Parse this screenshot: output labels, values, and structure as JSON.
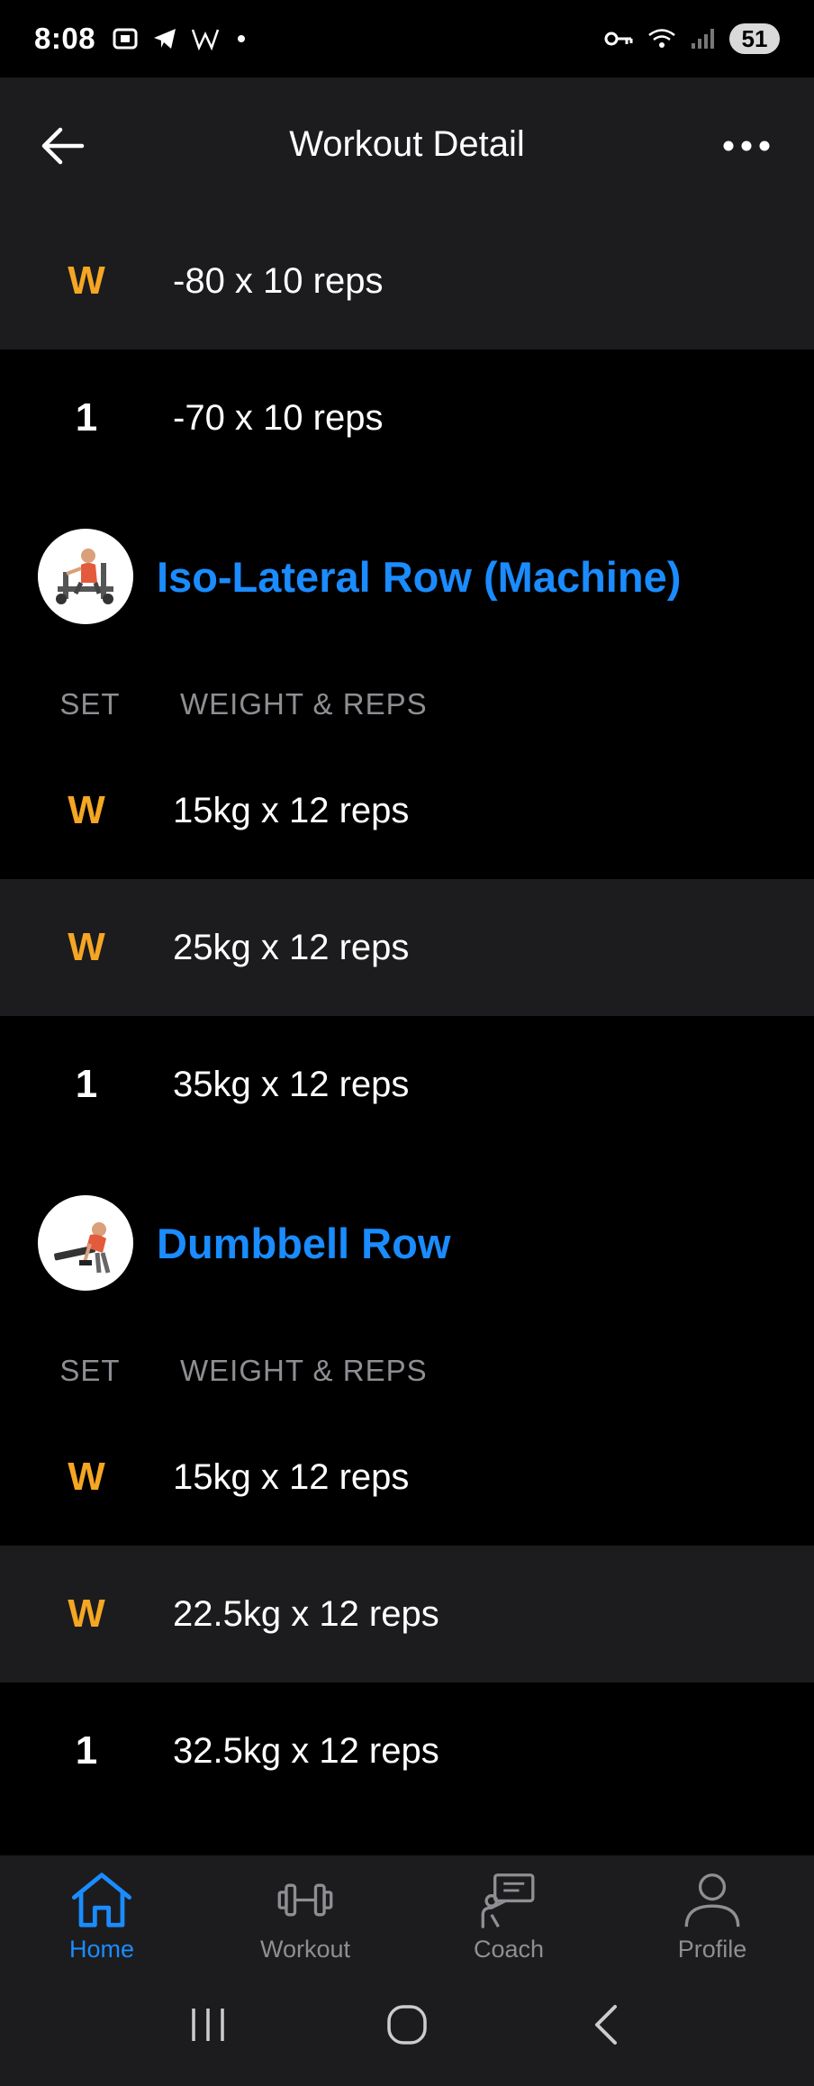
{
  "status_bar": {
    "time": "8:08",
    "left_icons": [
      "screenshot-icon",
      "telegram-icon",
      "w-icon",
      "dot-icon"
    ],
    "battery": "51"
  },
  "header": {
    "title": "Workout Detail"
  },
  "top_sets": [
    {
      "label": "W",
      "kind": "warmup",
      "value": "-80 x 10 reps"
    },
    {
      "label": "1",
      "kind": "normal",
      "value": "-70 x 10 reps"
    }
  ],
  "exercises": [
    {
      "name": "Iso-Lateral Row (Machine)",
      "col_set": "SET",
      "col_weight": "WEIGHT & REPS",
      "sets": [
        {
          "label": "W",
          "kind": "warmup",
          "value": "15kg x 12 reps"
        },
        {
          "label": "W",
          "kind": "warmup",
          "value": "25kg x 12 reps"
        },
        {
          "label": "1",
          "kind": "normal",
          "value": "35kg x 12 reps"
        }
      ]
    },
    {
      "name": "Dumbbell Row",
      "col_set": "SET",
      "col_weight": "WEIGHT & REPS",
      "sets": [
        {
          "label": "W",
          "kind": "warmup",
          "value": "15kg x 12 reps"
        },
        {
          "label": "W",
          "kind": "warmup",
          "value": "22.5kg x 12 reps"
        },
        {
          "label": "1",
          "kind": "normal",
          "value": "32.5kg x 12 reps"
        }
      ]
    }
  ],
  "bottom_nav": {
    "items": [
      {
        "label": "Home",
        "icon": "home-icon",
        "active": true
      },
      {
        "label": "Workout",
        "icon": "dumbbell-icon",
        "active": false
      },
      {
        "label": "Coach",
        "icon": "coach-icon",
        "active": false
      },
      {
        "label": "Profile",
        "icon": "profile-icon",
        "active": false
      }
    ]
  },
  "colors": {
    "accent": "#1a8cff",
    "warmup": "#f5a623",
    "surface": "#1c1c1e",
    "background": "#000000",
    "muted": "#8e8e93"
  }
}
